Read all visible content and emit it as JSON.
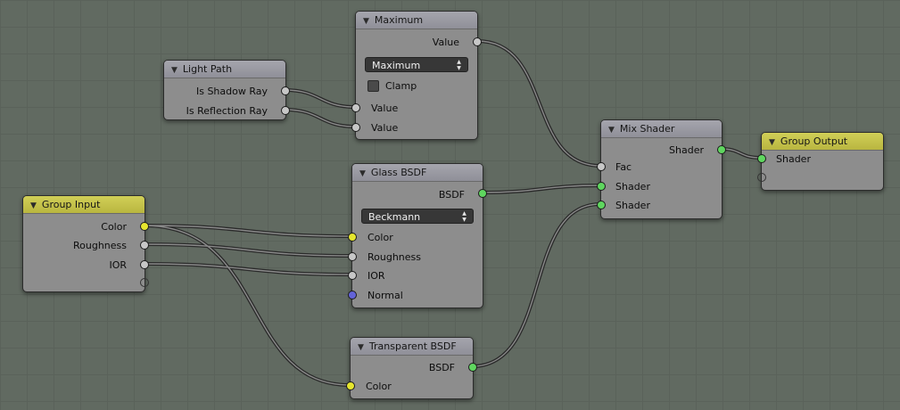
{
  "nodes": {
    "light_path": {
      "title": "Light Path",
      "outputs": [
        "Is Shadow Ray",
        "Is Reflection Ray"
      ]
    },
    "maximum": {
      "title": "Maximum",
      "output": "Value",
      "operation": "Maximum",
      "clamp_label": "Clamp",
      "inputs": [
        "Value",
        "Value"
      ]
    },
    "glass_bsdf": {
      "title": "Glass BSDF",
      "output": "BSDF",
      "distribution": "Beckmann",
      "inputs": [
        "Color",
        "Roughness",
        "IOR",
        "Normal"
      ]
    },
    "group_input": {
      "title": "Group Input",
      "outputs": [
        "Color",
        "Roughness",
        "IOR"
      ]
    },
    "transparent_bsdf": {
      "title": "Transparent BSDF",
      "output": "BSDF",
      "inputs": [
        "Color"
      ]
    },
    "mix_shader": {
      "title": "Mix Shader",
      "output": "Shader",
      "inputs": [
        "Fac",
        "Shader",
        "Shader"
      ]
    },
    "group_output": {
      "title": "Group Output",
      "inputs": [
        "Shader"
      ]
    }
  },
  "colors": {
    "background": "#616a61",
    "node_body": "#8d8d8d",
    "group_header": "#c9c64c",
    "socket_float": "#c7c7c7",
    "socket_color": "#e6e62e",
    "socket_shader": "#5fd65f",
    "socket_vector": "#6363d8",
    "link": "#2e2e2e"
  },
  "icons": {
    "collapse": "triangle-down-icon",
    "dropdown": "updown-arrows-icon",
    "checkbox": "checkbox-unchecked-icon"
  }
}
